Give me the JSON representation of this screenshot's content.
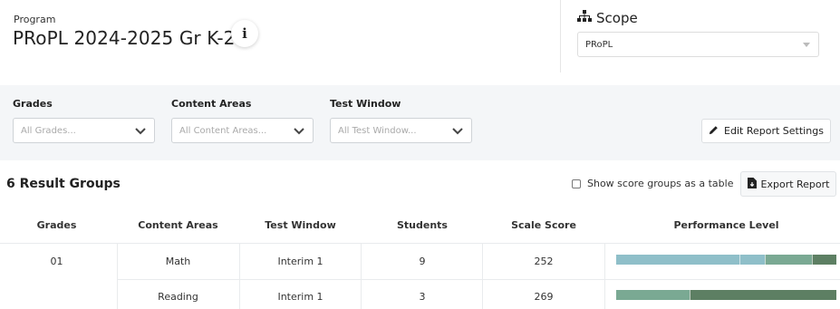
{
  "header": {
    "program_label": "Program",
    "program_title": "PRoPL 2024-2025 Gr K-2",
    "info_icon": "i"
  },
  "scope": {
    "label": "Scope",
    "selected": "PRoPL"
  },
  "filters": {
    "grades": {
      "label": "Grades",
      "placeholder": "All Grades..."
    },
    "content_areas": {
      "label": "Content Areas",
      "placeholder": "All Content Areas..."
    },
    "test_window": {
      "label": "Test Window",
      "placeholder": "All Test Window..."
    },
    "edit_button": "Edit Report Settings"
  },
  "results": {
    "title": "6 Result Groups",
    "table_toggle_label": "Show score groups as a table",
    "export_button": "Export Report"
  },
  "table": {
    "columns": [
      "Grades",
      "Content Areas",
      "Test Window",
      "Students",
      "Scale Score",
      "Performance Level"
    ],
    "rows": [
      {
        "grade": "01",
        "content_area": "Math",
        "test_window": "Interim 1",
        "students": "9",
        "scale_score": "252",
        "performance": [
          {
            "fraction": 0.56,
            "color": "#8fbfc9"
          },
          {
            "fraction": 0.115,
            "color": "#8fbfc9"
          },
          {
            "fraction": 0.215,
            "color": "#7aa993"
          },
          {
            "fraction": 0.11,
            "color": "#5d7f63"
          }
        ]
      },
      {
        "grade": "",
        "content_area": "Reading",
        "test_window": "Interim 1",
        "students": "3",
        "scale_score": "269",
        "performance": [
          {
            "fraction": 0.335,
            "color": "#7aa993"
          },
          {
            "fraction": 0.665,
            "color": "#5d7f63"
          }
        ]
      }
    ]
  },
  "icons": {
    "scope": "sitemap-icon",
    "edit": "pencil-icon",
    "export": "file-export-icon",
    "info": "info-icon"
  }
}
